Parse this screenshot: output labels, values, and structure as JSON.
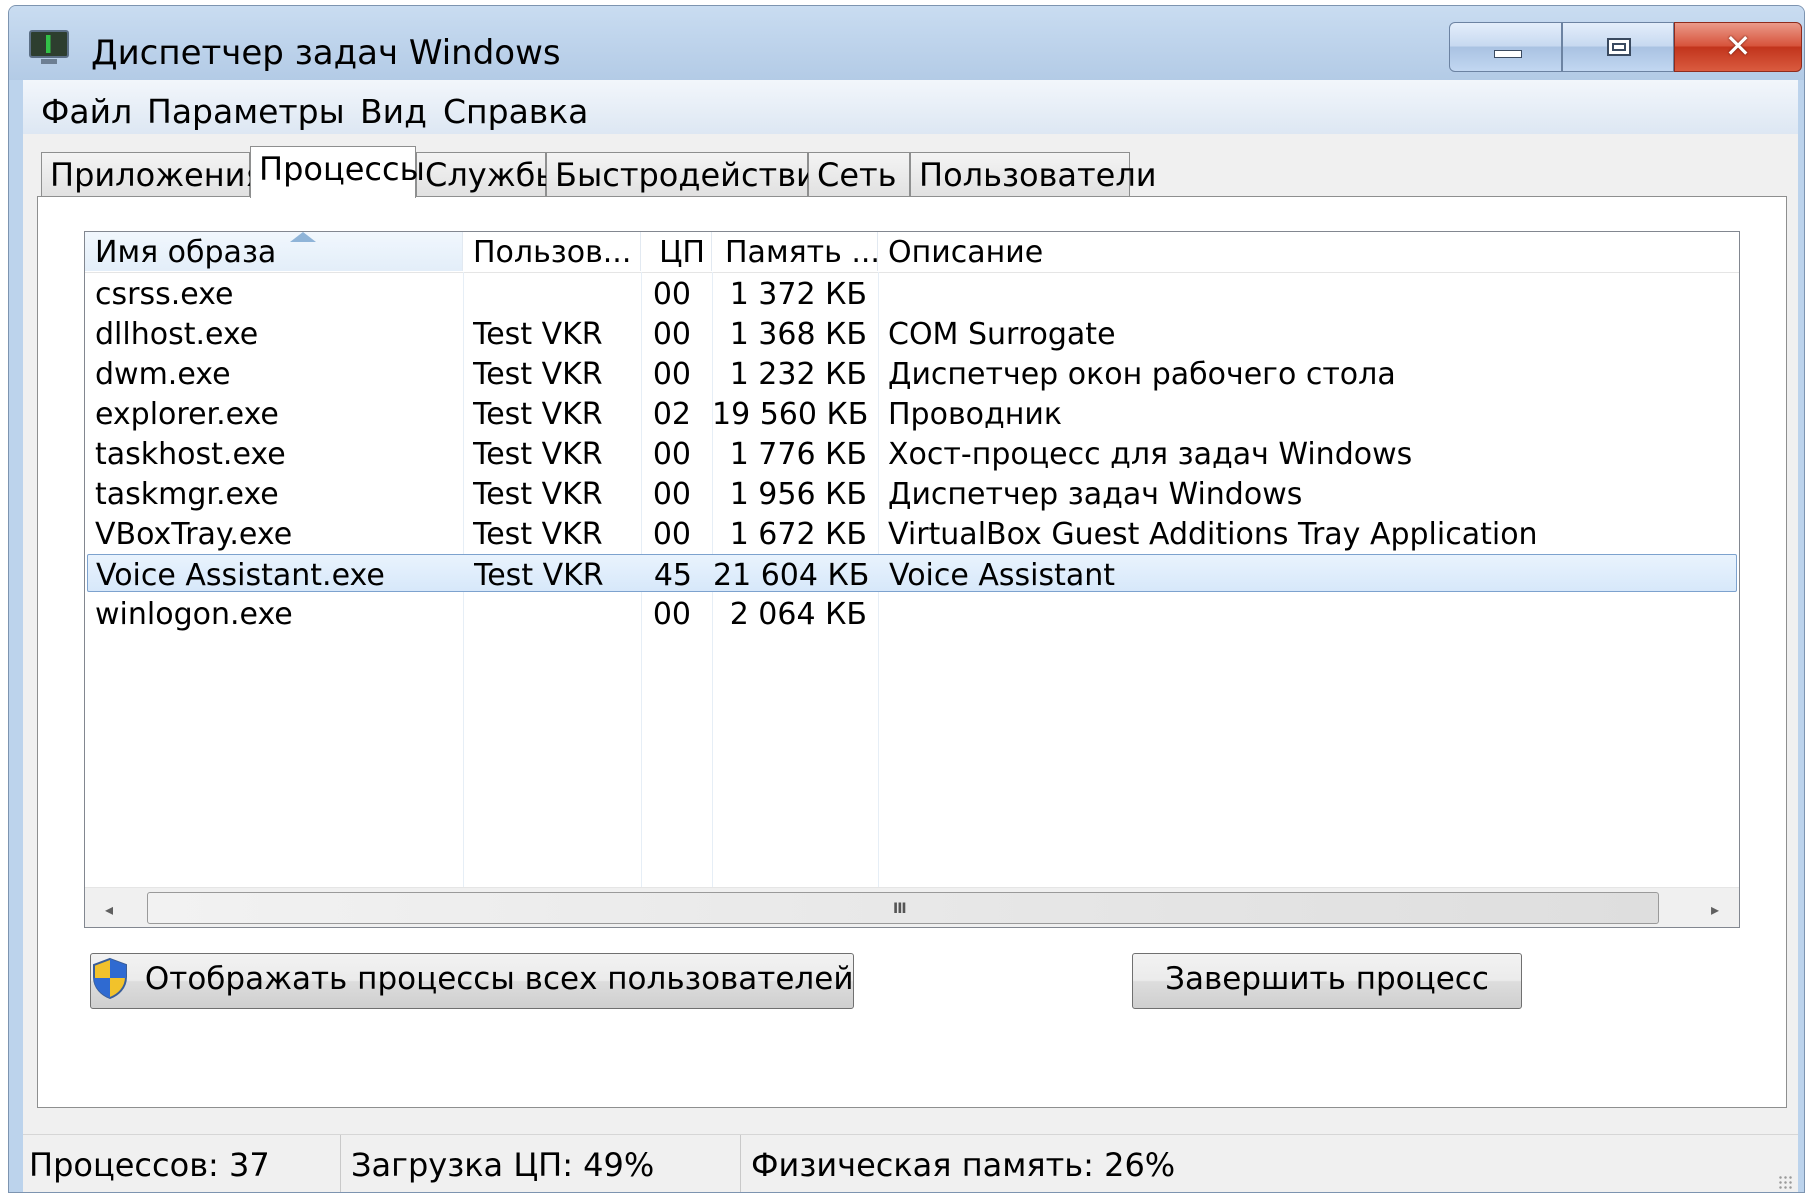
{
  "window": {
    "title": "Диспетчер задач Windows",
    "icons": {
      "app": "task-manager-monitor-icon",
      "minimize": "minimize-icon",
      "maximize": "maximize-icon",
      "close": "close-icon"
    },
    "close_glyph": "✕"
  },
  "menu": [
    "Файл",
    "Параметры",
    "Вид",
    "Справка"
  ],
  "tabs": [
    {
      "label": "Приложения",
      "active": false
    },
    {
      "label": "Процессы",
      "active": true
    },
    {
      "label": "Службы",
      "active": false
    },
    {
      "label": "Быстродействие",
      "active": false
    },
    {
      "label": "Сеть",
      "active": false
    },
    {
      "label": "Пользователи",
      "active": false
    }
  ],
  "table": {
    "columns": [
      "Имя образа",
      "Пользов...",
      "ЦП",
      "Память ...",
      "Описание"
    ],
    "sorted_column": "Имя образа",
    "rows": [
      {
        "name": "csrss.exe",
        "user": "",
        "cpu": "00",
        "mem": "1 372 КБ",
        "desc": "",
        "selected": false
      },
      {
        "name": "dllhost.exe",
        "user": "Test VKR",
        "cpu": "00",
        "mem": "1 368 КБ",
        "desc": "COM Surrogate",
        "selected": false
      },
      {
        "name": "dwm.exe",
        "user": "Test VKR",
        "cpu": "00",
        "mem": "1 232 КБ",
        "desc": "Диспетчер окон рабочего стола",
        "selected": false
      },
      {
        "name": "explorer.exe",
        "user": "Test VKR",
        "cpu": "02",
        "mem": "19 560 КБ",
        "desc": "Проводник",
        "selected": false
      },
      {
        "name": "taskhost.exe",
        "user": "Test VKR",
        "cpu": "00",
        "mem": "1 776 КБ",
        "desc": "Хост-процесс для задач Windows",
        "selected": false
      },
      {
        "name": "taskmgr.exe",
        "user": "Test VKR",
        "cpu": "00",
        "mem": "1 956 КБ",
        "desc": "Диспетчер задач Windows",
        "selected": false
      },
      {
        "name": "VBoxTray.exe",
        "user": "Test VKR",
        "cpu": "00",
        "mem": "1 672 КБ",
        "desc": "VirtualBox Guest Additions Tray Application",
        "selected": false
      },
      {
        "name": "Voice Assistant.exe",
        "user": "Test VKR",
        "cpu": "45",
        "mem": "21 604 КБ",
        "desc": "Voice Assistant",
        "selected": true
      },
      {
        "name": "winlogon.exe",
        "user": "",
        "cpu": "00",
        "mem": "2 064 КБ",
        "desc": "",
        "selected": false
      }
    ],
    "scrollbar": {
      "left_arrow": "◂",
      "right_arrow": "▸",
      "grip": "III"
    }
  },
  "buttons": {
    "show_all_processes": "Отображать процессы всех пользователей",
    "end_process": "Завершить процесс"
  },
  "status": {
    "processes": "Процессов: 37",
    "cpu": "Загрузка ЦП: 49%",
    "memory": "Физическая память: 26%"
  },
  "colors": {
    "selection": "#d7e8fa",
    "selection_border": "#7da2ce",
    "titlebar": "#bcd3ec",
    "close_button": "#c1341c"
  }
}
